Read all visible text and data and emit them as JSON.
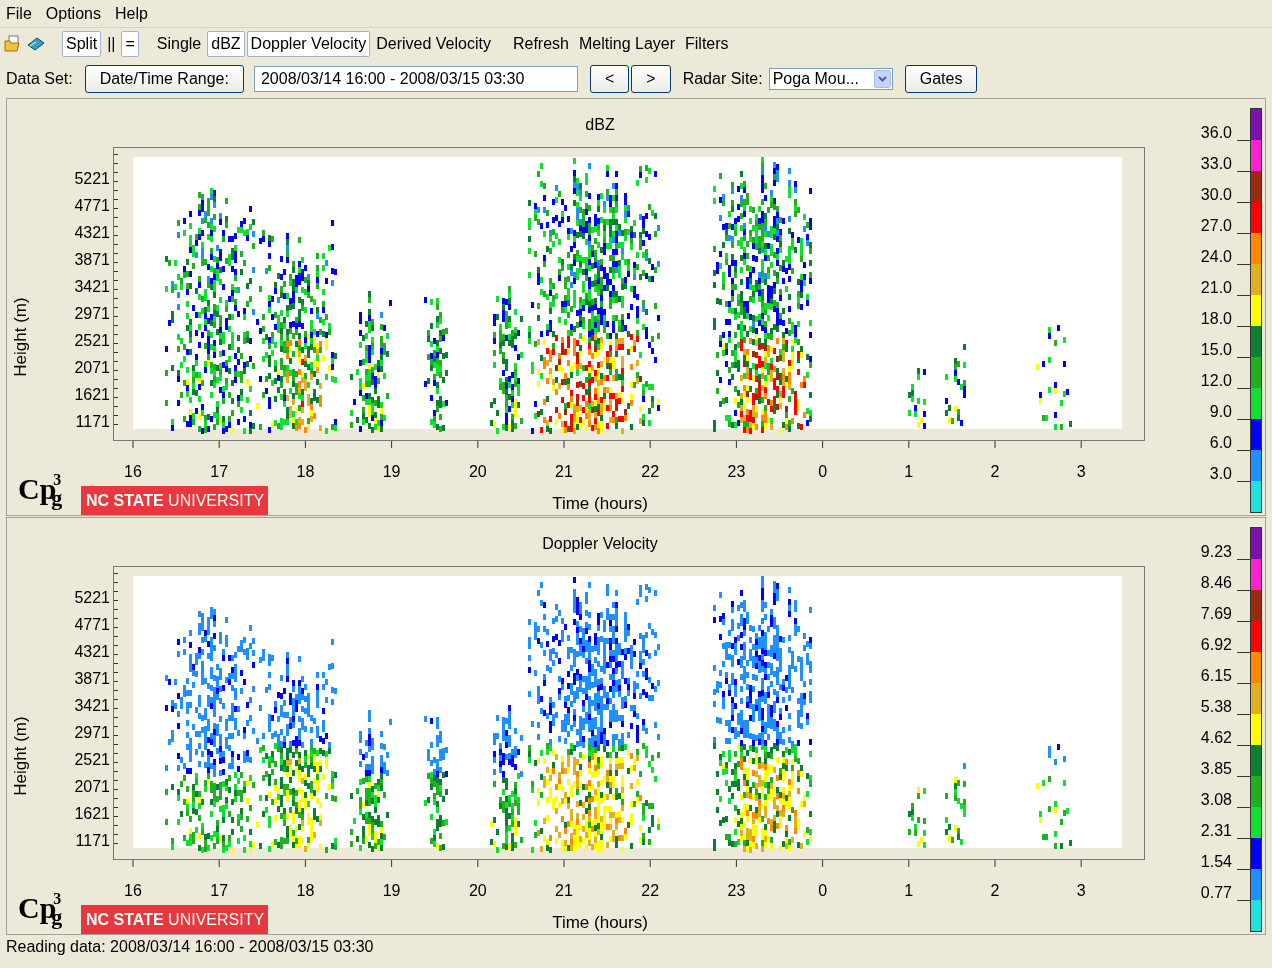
{
  "menu": [
    "File",
    "Options",
    "Help"
  ],
  "toolbar": {
    "items": [
      {
        "label": "Split",
        "selected": true
      },
      {
        "label": "||",
        "selected": false
      },
      {
        "label": "=",
        "selected": true
      },
      {
        "label": "Single",
        "selected": false
      },
      {
        "label": "dBZ",
        "selected": true
      },
      {
        "label": "Doppler Velocity",
        "selected": true
      },
      {
        "label": "Derived Velocity",
        "selected": false
      },
      {
        "label": "Refresh",
        "selected": false
      },
      {
        "label": "Melting Layer",
        "selected": false
      },
      {
        "label": "Filters",
        "selected": false
      }
    ]
  },
  "dataset": {
    "label": "Data Set:",
    "range_button": "Date/Time Range:",
    "range_value": "2008/03/14 16:00 - 2008/03/15 03:30",
    "prev_button": "<",
    "next_button": ">",
    "site_label": "Radar Site:",
    "site_value": "Poga Mou...",
    "gates_button": "Gates"
  },
  "panels": [
    {
      "title": "dBZ",
      "kind": "reflectivity",
      "y_label": "Height (m)",
      "x_label": "Time (hours)",
      "y_ticks": [
        "5221",
        "4771",
        "4321",
        "3871",
        "3421",
        "2971",
        "2521",
        "2071",
        "1621",
        "1171"
      ],
      "x_ticks": [
        "16",
        "17",
        "18",
        "19",
        "20",
        "21",
        "22",
        "23",
        "0",
        "1",
        "2",
        "3"
      ],
      "colorbar": [
        {
          "color": "#7a10b0"
        },
        {
          "color": "#ff20d0"
        },
        {
          "color": "#9a2a10"
        },
        {
          "color": "#ff0000"
        },
        {
          "color": "#ff8800"
        },
        {
          "color": "#e0b020"
        },
        {
          "color": "#ffff00"
        },
        {
          "color": "#0a8030"
        },
        {
          "color": "#20b020"
        },
        {
          "color": "#10e030"
        },
        {
          "color": "#0000ff"
        },
        {
          "color": "#1e90ff"
        },
        {
          "color": "#20e0e0"
        }
      ],
      "colorbar_labels": [
        "36.0",
        "33.0",
        "30.0",
        "27.0",
        "24.0",
        "21.0",
        "18.0",
        "15.0",
        "12.0",
        "9.0",
        "6.0",
        "3.0"
      ],
      "logo": {
        "letters": "Cp",
        "raised": "3",
        "lowered": "g"
      },
      "banner": {
        "bold": "NC STATE",
        "rest": "UNIVERSITY"
      }
    },
    {
      "title": "Doppler Velocity",
      "kind": "velocity",
      "y_label": "Height (m)",
      "x_label": "Time (hours)",
      "y_ticks": [
        "5221",
        "4771",
        "4321",
        "3871",
        "3421",
        "2971",
        "2521",
        "2071",
        "1621",
        "1171"
      ],
      "x_ticks": [
        "16",
        "17",
        "18",
        "19",
        "20",
        "21",
        "22",
        "23",
        "0",
        "1",
        "2",
        "3"
      ],
      "colorbar": [
        {
          "color": "#7a10b0"
        },
        {
          "color": "#ff20d0"
        },
        {
          "color": "#9a2a10"
        },
        {
          "color": "#ff0000"
        },
        {
          "color": "#ff8800"
        },
        {
          "color": "#e0b020"
        },
        {
          "color": "#ffff00"
        },
        {
          "color": "#0a8030"
        },
        {
          "color": "#20b020"
        },
        {
          "color": "#10e030"
        },
        {
          "color": "#0000ff"
        },
        {
          "color": "#1e90ff"
        },
        {
          "color": "#20e0e0"
        }
      ],
      "colorbar_labels": [
        "9.23",
        "8.46",
        "7.69",
        "6.92",
        "6.15",
        "5.38",
        "4.62",
        "3.85",
        "3.08",
        "2.31",
        "1.54",
        "0.77"
      ],
      "logo": {
        "letters": "Cp",
        "raised": "3",
        "lowered": "g"
      },
      "banner": {
        "bold": "NC STATE",
        "rest": "UNIVERSITY"
      }
    }
  ],
  "status_bar": "Reading data: 2008/03/14 16:00 - 2008/03/15 03:30"
}
